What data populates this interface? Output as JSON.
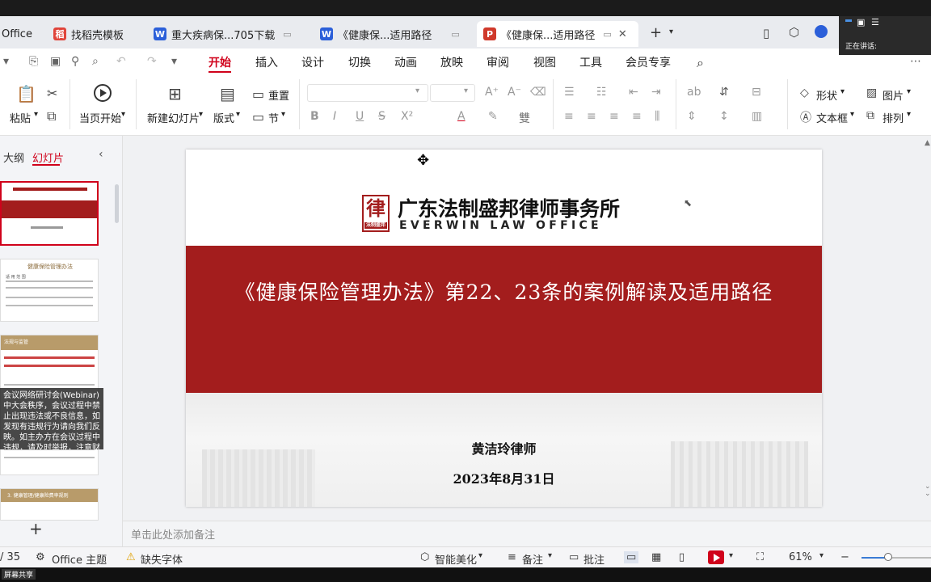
{
  "tabs": [
    {
      "label": "Office",
      "icon": "office-icon",
      "active": false
    },
    {
      "label": "找稻壳模板",
      "icon": "docer-icon",
      "active": false
    },
    {
      "label": "重大疾病保...705下载",
      "icon": "word-icon",
      "active": false
    },
    {
      "label": "《健康保...适用路径",
      "icon": "word-icon",
      "active": false
    },
    {
      "label": "《健康保...适用路径",
      "icon": "ppt-icon",
      "active": true
    }
  ],
  "tab_icons": {
    "docer": "稻",
    "word": "W",
    "ppt": "P"
  },
  "new_tab": "+",
  "menu": {
    "items": [
      "开始",
      "插入",
      "设计",
      "切换",
      "动画",
      "放映",
      "审阅",
      "视图",
      "工具",
      "会员专享"
    ],
    "active": "开始"
  },
  "ribbon": {
    "paste": "粘贴",
    "play_from_current": "当页开始",
    "new_slide": "新建幻灯片",
    "layout": "版式",
    "reset": "重置",
    "section": "节",
    "shape": "形状",
    "picture": "图片",
    "textbox": "文本框",
    "arrange": "排列"
  },
  "left_pane": {
    "tab_outline": "大纲",
    "tab_slides": "幻灯片",
    "thumb2_title": "健康保险管理办法",
    "thumb2_sub": "适 用 范 围",
    "thumb3_title": "法规与监管",
    "thumb4_title": "3. 健康管理/健康险费率规则",
    "popup_text": "会议网络研讨会(Webinar)中大会秩序，会议过程中禁止出现违法或不良信息，如发现有违规行为请向我们反映。如主办方在会议过程中违规，请及时举报，注意财产安全，谨防诈骗。",
    "add_slide": "+"
  },
  "slide": {
    "firm_cn": "广东法制盛邦律师事务所",
    "firm_en": "EVERWIN LAW OFFICE",
    "logo_char": "律",
    "logo_sub": "法制盛邦",
    "title": "《健康保险管理办法》第22、23条的案例解读及适用路径",
    "author": "黄洁玲律师",
    "date": "2023年8月31日"
  },
  "notes_placeholder": "单击此处添加备注",
  "status": {
    "page": "/ 35",
    "theme": "Office 主题",
    "missing_font": "缺失字体",
    "smart_beautify": "智能美化",
    "notes": "备注",
    "comments": "批注",
    "zoom": "61%",
    "zoom_fraction": 0.61
  },
  "overlay": {
    "speaking": "正在讲话:"
  },
  "bottom_strip": {
    "text": "屏幕共享"
  },
  "colors": {
    "brand_red": "#a31d1d",
    "accent": "#d0021b"
  }
}
